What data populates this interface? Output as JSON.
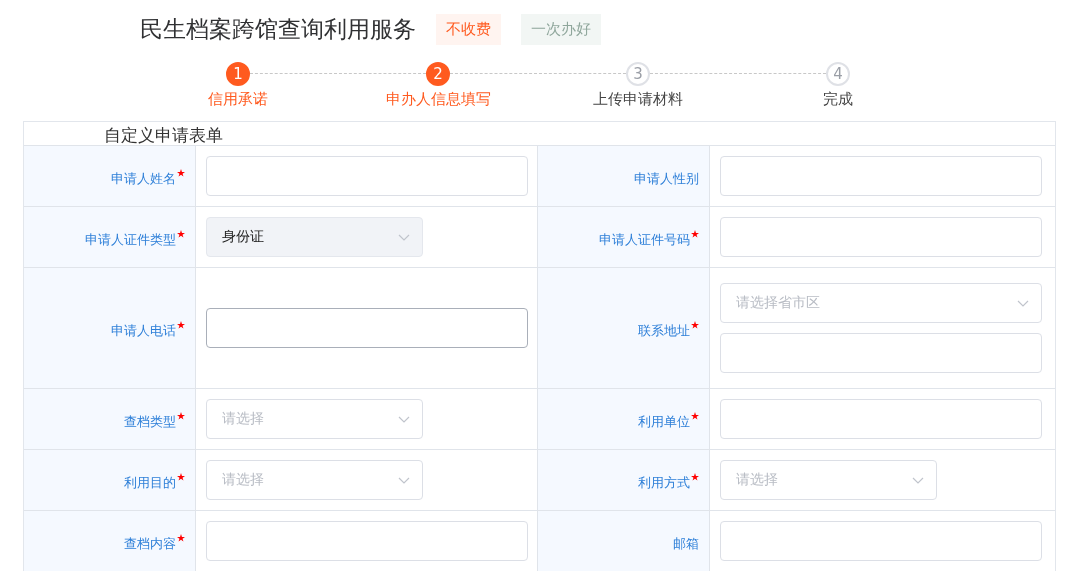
{
  "title": "民生档案跨馆查询利用服务",
  "tags": [
    {
      "label": "不收费",
      "kind": "fee"
    },
    {
      "label": "一次办好",
      "kind": "once"
    }
  ],
  "steps": [
    {
      "number": "1",
      "label": "信用承诺",
      "reached": true
    },
    {
      "number": "2",
      "label": "申办人信息填写",
      "reached": true
    },
    {
      "number": "3",
      "label": "上传申请材料",
      "reached": false
    },
    {
      "number": "4",
      "label": "完成",
      "reached": false
    }
  ],
  "form": {
    "title": "自定义申请表单",
    "rows": [
      {
        "cells": [
          {
            "label": "申请人姓名",
            "required": true,
            "controls": [
              {
                "kind": "input",
                "focused": false
              }
            ]
          },
          {
            "label": "申请人性别",
            "required": false,
            "controls": [
              {
                "kind": "input",
                "focused": false
              }
            ]
          }
        ]
      },
      {
        "cells": [
          {
            "label": "申请人证件类型",
            "required": true,
            "controls": [
              {
                "kind": "select",
                "value": "身份证",
                "filled": true
              }
            ]
          },
          {
            "label": "申请人证件号码",
            "required": true,
            "controls": [
              {
                "kind": "input",
                "focused": false
              }
            ]
          }
        ]
      },
      {
        "cells": [
          {
            "label": "申请人电话",
            "required": true,
            "controls": [
              {
                "kind": "input",
                "focused": true
              }
            ]
          },
          {
            "label": "联系地址",
            "required": true,
            "controls": [
              {
                "kind": "select-wide",
                "placeholder": "请选择省市区",
                "filled": false
              },
              {
                "kind": "input",
                "focused": false
              }
            ]
          }
        ]
      },
      {
        "cells": [
          {
            "label": "查档类型",
            "required": true,
            "controls": [
              {
                "kind": "select",
                "placeholder": "请选择",
                "filled": false
              }
            ]
          },
          {
            "label": "利用单位",
            "required": true,
            "controls": [
              {
                "kind": "input",
                "focused": false
              }
            ]
          }
        ]
      },
      {
        "cells": [
          {
            "label": "利用目的",
            "required": true,
            "controls": [
              {
                "kind": "select",
                "placeholder": "请选择",
                "filled": false
              }
            ]
          },
          {
            "label": "利用方式",
            "required": true,
            "controls": [
              {
                "kind": "select",
                "placeholder": "请选择",
                "filled": false
              }
            ]
          }
        ]
      },
      {
        "cells": [
          {
            "label": "查档内容",
            "required": true,
            "controls": [
              {
                "kind": "input",
                "focused": false
              }
            ]
          },
          {
            "label": "邮箱",
            "required": false,
            "controls": [
              {
                "kind": "input",
                "focused": false
              }
            ]
          }
        ]
      }
    ]
  }
}
